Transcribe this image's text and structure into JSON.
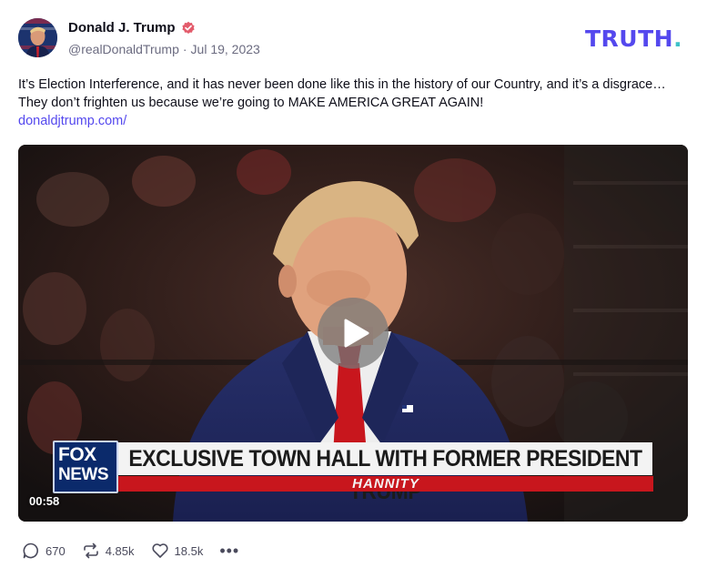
{
  "author": {
    "display_name": "Donald J. Trump",
    "handle": "@realDonaldTrump",
    "separator": "·",
    "date": "Jul 19, 2023",
    "verified_icon": "verified-badge-icon"
  },
  "brand": {
    "name": "TRUTH",
    "dot": "."
  },
  "post": {
    "text": "It’s Election Interference, and it has never been done like this in the history of our Country, and it’s a disgrace…They don’t frighten us because we’re going to MAKE AMERICA GREAT AGAIN!",
    "link": "donaldjtrump.com/"
  },
  "video": {
    "duration": "00:58",
    "chyron_headline": "EXCLUSIVE TOWN HALL WITH FORMER PRESIDENT TRUMP",
    "chyron_sub": "HANNITY",
    "logo_line1": "FOX",
    "logo_line2": "NEWS",
    "play_icon": "play-icon"
  },
  "actions": {
    "replies": "670",
    "retruths": "4.85k",
    "likes": "18.5k",
    "more_label": "•••"
  },
  "colors": {
    "brand": "#5448ee",
    "brand_dot": "#3ec1c9",
    "link": "#5448ee",
    "verified": "#e35b6b",
    "chyron_red": "#c8161d"
  }
}
